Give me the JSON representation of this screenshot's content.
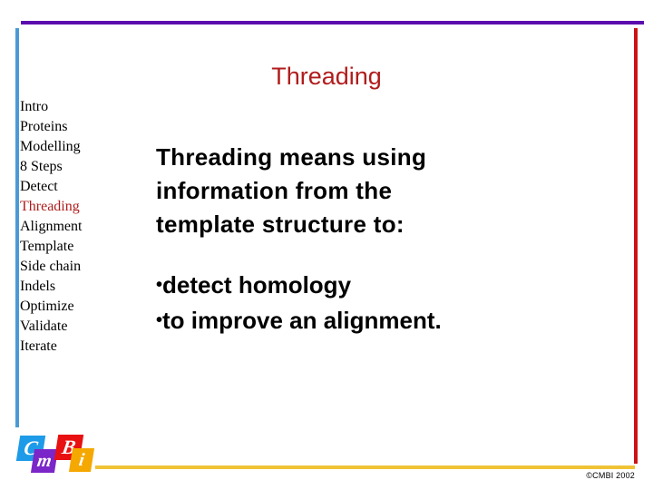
{
  "slide": {
    "title": "Threading"
  },
  "sidebar": {
    "items": [
      {
        "label": "Intro",
        "active": false
      },
      {
        "label": "Proteins",
        "active": false
      },
      {
        "label": "Modelling",
        "active": false
      },
      {
        "label": "8 Steps",
        "active": false
      },
      {
        "label": "Detect",
        "active": false
      },
      {
        "label": "Threading",
        "active": true
      },
      {
        "label": "Alignment",
        "active": false
      },
      {
        "label": "Template",
        "active": false
      },
      {
        "label": "Side chain",
        "active": false
      },
      {
        "label": "Indels",
        "active": false
      },
      {
        "label": "Optimize",
        "active": false
      },
      {
        "label": "Validate",
        "active": false
      },
      {
        "label": "Iterate",
        "active": false
      }
    ]
  },
  "content": {
    "heading_lines": [
      "Threading means using",
      "information from the",
      "template structure to:"
    ],
    "bullets": [
      {
        "glyph": "•",
        "text": "detect homology"
      },
      {
        "glyph": "•",
        "text": "to improve an alignment."
      }
    ]
  },
  "logo": {
    "tiles": [
      {
        "letter": "C",
        "color": "#1E9BE8"
      },
      {
        "letter": "m",
        "color": "#7B26C8"
      },
      {
        "letter": "B",
        "color": "#E81010"
      },
      {
        "letter": "i",
        "color": "#F5A800"
      }
    ]
  },
  "footer": {
    "copyright": "©CMBI 2002"
  },
  "colors": {
    "top_rule": "#5B0CAF",
    "left_rule": "#4A9BD4",
    "right_rule": "#CC1414",
    "bottom_rule": "#EFC335",
    "title": "#B01C1C",
    "active_nav": "#B01C1C",
    "body_text": "#000000"
  }
}
